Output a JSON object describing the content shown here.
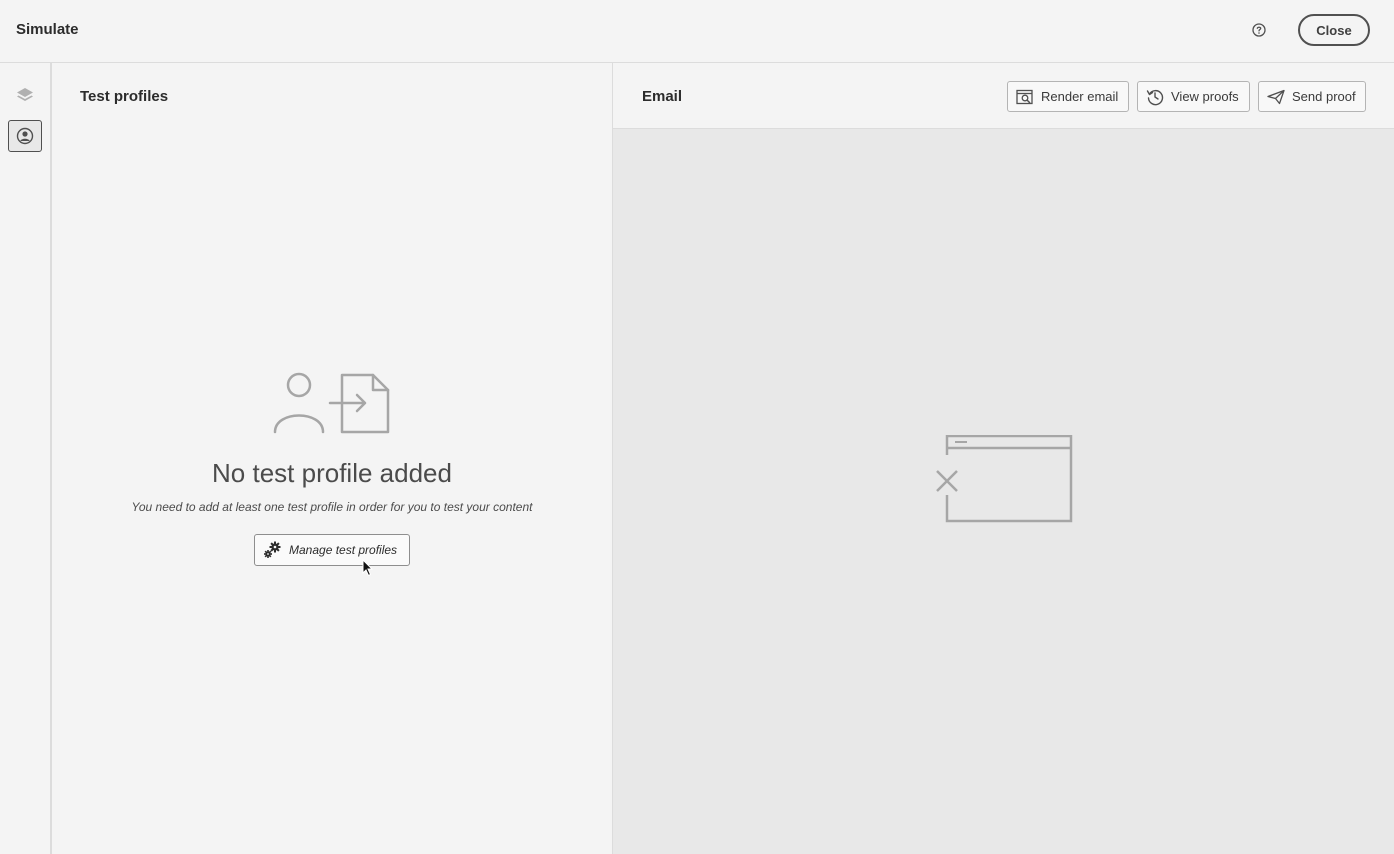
{
  "header": {
    "title": "Simulate",
    "help_icon": "help-circle-icon",
    "close_label": "Close"
  },
  "rail": {
    "items": [
      {
        "icon": "layers-icon",
        "selected": false
      },
      {
        "icon": "user-profile-icon",
        "selected": true
      }
    ]
  },
  "left_panel": {
    "title": "Test profiles",
    "empty_state": {
      "illustration": "user-add-document-illustration",
      "heading": "No test profile added",
      "description": "You need to add at least one test profile in order for you to test your content",
      "button_label": "Manage test profiles",
      "button_icon": "gears-icon"
    }
  },
  "right_panel": {
    "title": "Email",
    "buttons": [
      {
        "label": "Render email",
        "icon": "render-preview-icon"
      },
      {
        "label": "View proofs",
        "icon": "history-clock-icon"
      },
      {
        "label": "Send proof",
        "icon": "paper-plane-icon"
      }
    ],
    "preview_illustration": "broken-window-illustration"
  },
  "colors": {
    "background": "#f4f4f4",
    "preview_background": "#e8e8e8",
    "border": "#dcdcdc",
    "text": "#2c2c2c"
  }
}
